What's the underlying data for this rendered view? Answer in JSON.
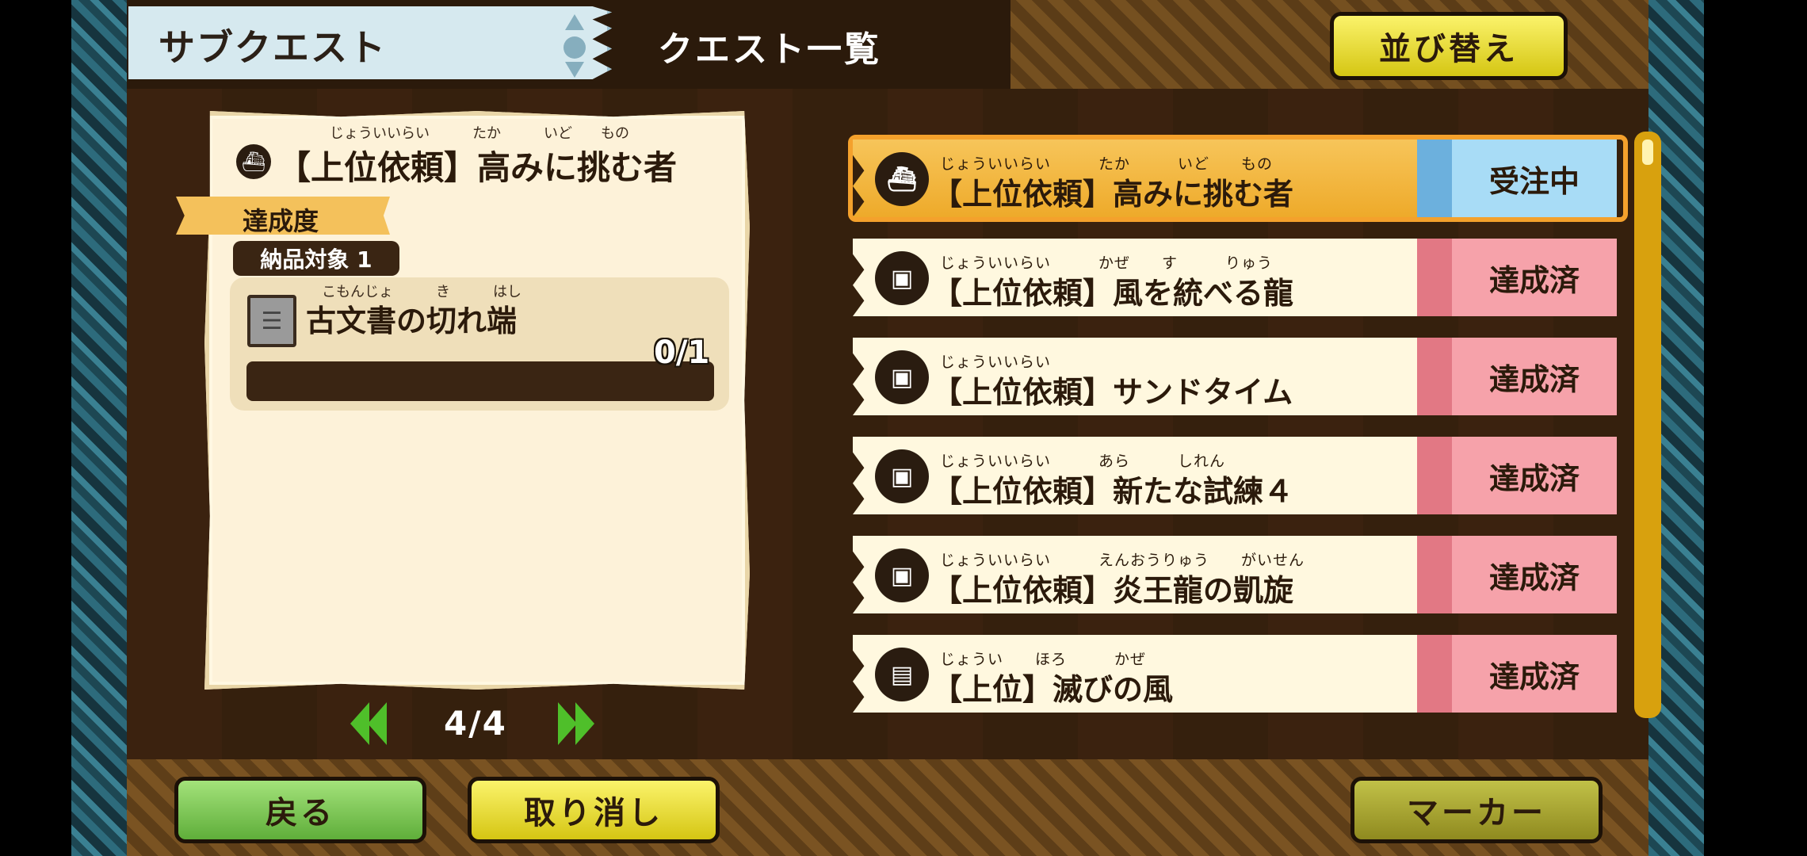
{
  "header": {
    "tab_label": "サブクエスト",
    "screen_title": "クエスト一覧",
    "sort_label": "並び替え"
  },
  "detail": {
    "quest_ruby": "じょういいらい　　　たか　　　いど　　もの",
    "quest_title": "【上位依頼】高みに挑む者",
    "progress_label": "達成度",
    "delivery_label": "納品対象 1",
    "item_ruby": "こもんじょ　　　き　　　はし",
    "item_name": "古文書の切れ端",
    "item_count": "0/1",
    "item_progress": 0
  },
  "pager": {
    "text": "4/4"
  },
  "quests": [
    {
      "ruby": "じょういいらい　　　たか　　　いど　　もの",
      "name": "【上位依頼】高みに挑む者",
      "status": "受注中",
      "active": true,
      "icon": "ship-icon"
    },
    {
      "ruby": "じょういいらい　　　かぜ　　す　　　りゅう",
      "name": "【上位依頼】風を統べる龍",
      "status": "達成済",
      "active": false,
      "icon": "scroll-icon"
    },
    {
      "ruby": "じょういいらい",
      "name": "【上位依頼】サンドタイム",
      "status": "達成済",
      "active": false,
      "icon": "scroll-icon"
    },
    {
      "ruby": "じょういいらい　　　あら　　　しれん",
      "name": "【上位依頼】新たな試練４",
      "status": "達成済",
      "active": false,
      "icon": "scroll-icon"
    },
    {
      "ruby": "じょういいらい　　　えんおうりゅう　　がいせん",
      "name": "【上位依頼】炎王龍の凱旋",
      "status": "達成済",
      "active": false,
      "icon": "scroll-icon"
    },
    {
      "ruby": "じょうい　　ほろ　　　かぜ",
      "name": "【上位】滅びの風",
      "status": "達成済",
      "active": false,
      "icon": "page-icon"
    }
  ],
  "footer": {
    "back_label": "戻る",
    "cancel_label": "取り消し",
    "marker_label": "マーカー"
  },
  "colors": {
    "accent_yellow": "#f2d722",
    "active_row": "#f4a12c",
    "done_status": "#f6a2aa",
    "active_status": "#a8dcf6"
  }
}
